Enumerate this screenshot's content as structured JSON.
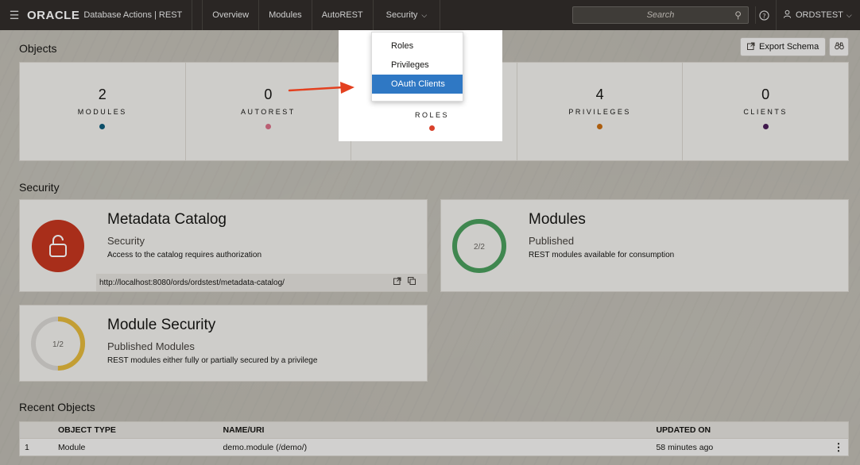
{
  "topbar": {
    "brand_logo": "ORACLE",
    "brand_product": "Database Actions | REST",
    "tabs": [
      "Overview",
      "Modules",
      "AutoREST"
    ],
    "security_tab": "Security",
    "search_placeholder": "Search",
    "username": "ORDSTEST"
  },
  "objects": {
    "title": "Objects",
    "export_label": "Export Schema",
    "counters": [
      {
        "num": "2",
        "label": "MODULES",
        "color": "#0d5b7a"
      },
      {
        "num": "0",
        "label": "AUTOREST",
        "color": "#d96f86"
      },
      {
        "num": "",
        "label": "ROLES",
        "color": "#d9412b"
      },
      {
        "num": "4",
        "label": "PRIVILEGES",
        "color": "#c96e12"
      },
      {
        "num": "0",
        "label": "CLIENTS",
        "color": "#4b1e5a"
      }
    ]
  },
  "security": {
    "title": "Security",
    "catalog": {
      "title": "Metadata Catalog",
      "subtitle": "Security",
      "desc": "Access to the catalog requires authorization",
      "url": "http://localhost:8080/ords/ordstest/metadata-catalog/"
    },
    "modules": {
      "title": "Modules",
      "subtitle": "Published",
      "desc": "REST modules available for consumption",
      "ratio": "2/2",
      "fraction": 1.0,
      "color": "#4a9e5c"
    },
    "module_security": {
      "title": "Module Security",
      "subtitle": "Published Modules",
      "desc": "REST modules either fully or partially secured by a privilege",
      "ratio": "1/2",
      "fraction": 0.5,
      "color": "#e3b93c"
    }
  },
  "recent": {
    "title": "Recent Objects",
    "headers": [
      "OBJECT TYPE",
      "NAME/URI",
      "UPDATED ON"
    ],
    "rows": [
      {
        "index": "1",
        "type": "Module",
        "name": "demo.module (/demo/)",
        "updated": "58 minutes ago"
      }
    ]
  },
  "dropdown": {
    "items": [
      "Roles",
      "Privileges",
      "OAuth Clients"
    ],
    "active_index": 2
  }
}
